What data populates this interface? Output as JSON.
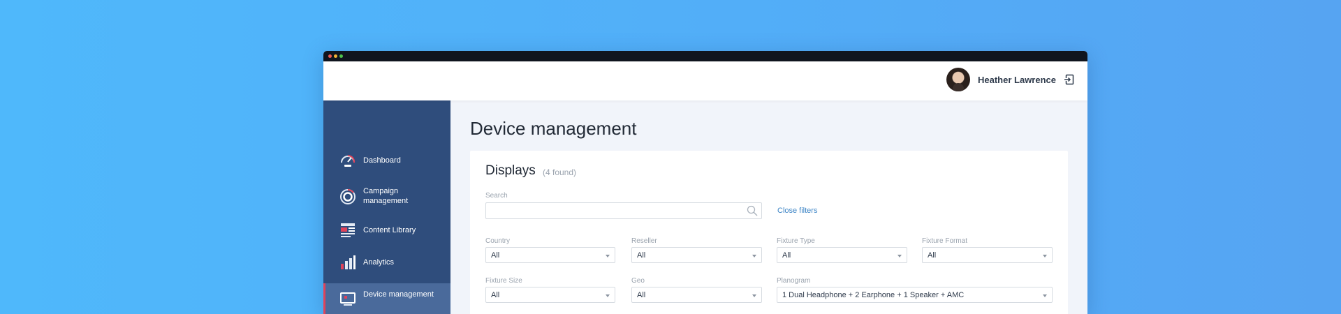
{
  "user": {
    "name": "Heather Lawrence"
  },
  "sidebar": {
    "items": [
      {
        "label": "Dashboard",
        "icon": "speedometer-icon"
      },
      {
        "label": "Campaign management",
        "icon": "target-icon"
      },
      {
        "label": "Content Library",
        "icon": "library-icon"
      },
      {
        "label": "Analytics",
        "icon": "bar-chart-icon"
      },
      {
        "label": "Device management",
        "icon": "monitor-icon",
        "active": true
      }
    ]
  },
  "main": {
    "title": "Device management",
    "card": {
      "title": "Displays",
      "count": "(4 found)",
      "search": {
        "label": "Search",
        "value": "",
        "placeholder": ""
      },
      "close_filters": "Close filters",
      "filters": [
        {
          "label": "Country",
          "value": "All"
        },
        {
          "label": "Reseller",
          "value": "All"
        },
        {
          "label": "Fixture Type",
          "value": "All"
        },
        {
          "label": "Fixture Format",
          "value": "All"
        },
        {
          "label": "Fixture Size",
          "value": "All"
        },
        {
          "label": "Geo",
          "value": "All"
        },
        {
          "label": "Planogram",
          "value": "1 Dual Headphone + 2 Earphone + 1 Speaker + AMC"
        }
      ]
    }
  },
  "colors": {
    "background": "#52aef8",
    "sidebar": "#2f4d7c",
    "sidebar_active": "#4a6a9b",
    "accent_red": "#e0435a",
    "link": "#3d85c6"
  }
}
